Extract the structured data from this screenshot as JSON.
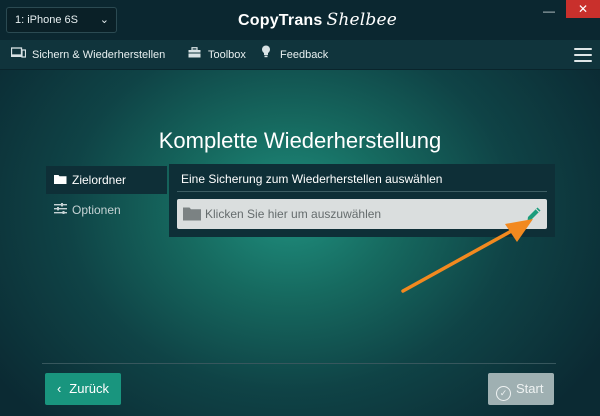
{
  "titlebar": {
    "device_selector": "1: iPhone 6S",
    "logo_main": "CopyTrans",
    "logo_script": "Shelbee",
    "minimize_symbol": "—",
    "close_symbol": "✕"
  },
  "nav": {
    "items": [
      {
        "label": "Sichern & Wiederherstellen",
        "icon": "computer-phone-icon"
      },
      {
        "label": "Toolbox",
        "icon": "toolbox-icon"
      },
      {
        "label": "Feedback",
        "icon": "lightbulb-icon"
      }
    ],
    "menu_icon": "hamburger-icon"
  },
  "page": {
    "title": "Komplette Wiederherstellung"
  },
  "sidebar": {
    "items": [
      {
        "label": "Zielordner",
        "icon": "folder-icon",
        "active": true
      },
      {
        "label": "Optionen",
        "icon": "sliders-icon",
        "active": false
      }
    ]
  },
  "panel": {
    "heading": "Eine Sicherung zum Wiederherstellen auswählen",
    "file_placeholder": "Klicken Sie hier um auszuwählen"
  },
  "footer": {
    "back_label": "Zurück",
    "back_icon": "‹",
    "start_label": "Start",
    "start_icon": "✓"
  },
  "colors": {
    "accent": "#19957e",
    "arrow": "#f2891f",
    "close": "#c9302c",
    "disabled_button": "#9fb0b2",
    "pencil": "#1a9c7c"
  }
}
